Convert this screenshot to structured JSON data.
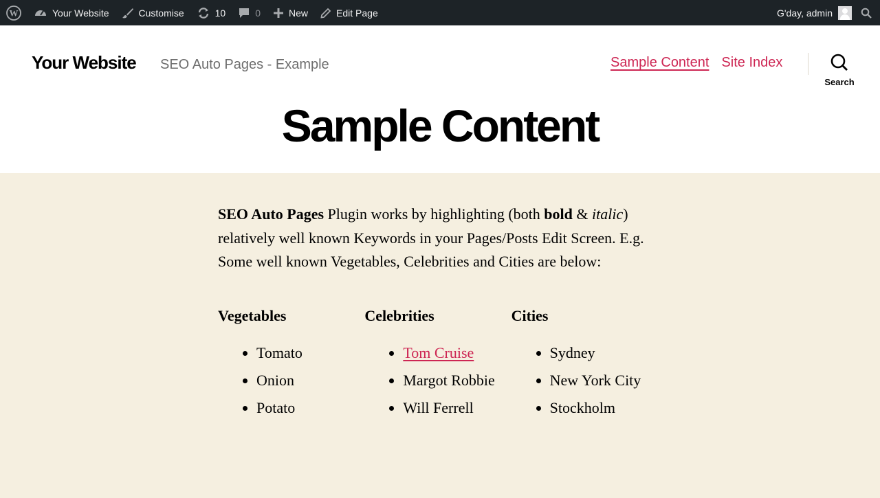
{
  "adminbar": {
    "site_name": "Your Website",
    "customise": "Customise",
    "updates_count": "10",
    "comments_count": "0",
    "new": "New",
    "edit_page": "Edit Page",
    "greeting": "G'day, admin"
  },
  "header": {
    "site_title": "Your Website",
    "site_description": "SEO Auto Pages - Example",
    "nav": [
      "Sample Content",
      "Site Index"
    ],
    "search_label": "Search"
  },
  "page": {
    "title": "Sample Content",
    "intro": {
      "bold_lead": "SEO Auto Pages",
      "text1": " Plugin works by highlighting (both ",
      "bold_word": "bold",
      "text2": " & ",
      "italic_word": "italic",
      "text3": ") relatively well known Keywords in your Pages/Posts Edit Screen. E.g. Some well known Vegetables, Celebrities and Cities are below:"
    },
    "columns": [
      {
        "heading": "Vegetables",
        "items": [
          "Tomato",
          "Onion",
          "Potato"
        ]
      },
      {
        "heading": "Celebrities",
        "items": [
          "Tom Cruise",
          "Margot Robbie",
          "Will Ferrell"
        ]
      },
      {
        "heading": "Cities",
        "items": [
          "Sydney",
          "New York City",
          "Stockholm"
        ]
      }
    ]
  },
  "colors": {
    "accent": "#cd2653",
    "adminbar_bg": "#1d2327",
    "content_bg": "#f5efe0"
  }
}
